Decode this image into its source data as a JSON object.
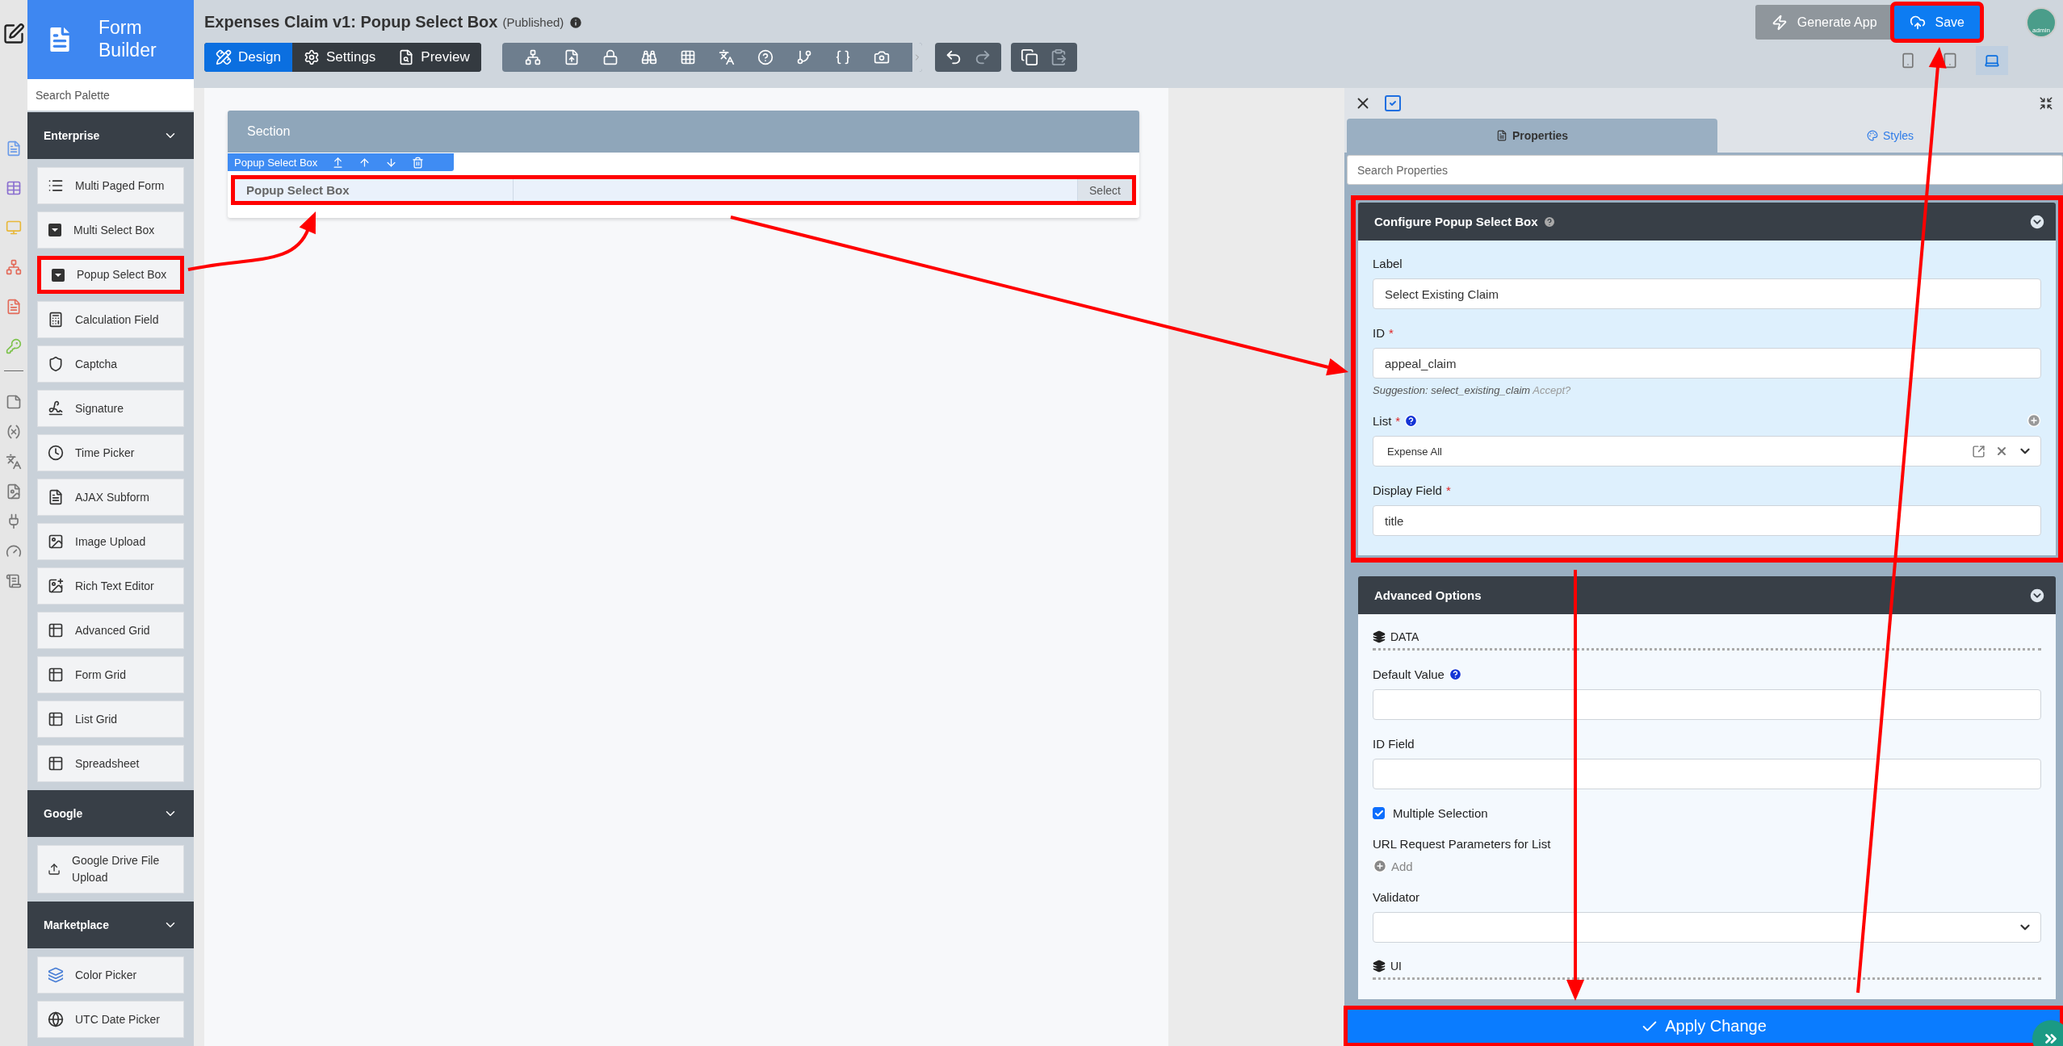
{
  "palette": {
    "title": "Form Builder",
    "search": {
      "placeholder": "Search Palette"
    },
    "groups": [
      {
        "title": "Enterprise",
        "expanded": true,
        "items": [
          {
            "label": "Multi Paged Form",
            "highlighted": false
          },
          {
            "label": "Multi Select Box",
            "highlighted": false
          },
          {
            "label": "Popup Select Box",
            "highlighted": true
          },
          {
            "label": "Calculation Field",
            "highlighted": false
          },
          {
            "label": "Captcha",
            "highlighted": false
          },
          {
            "label": "Signature",
            "highlighted": false
          },
          {
            "label": "Time Picker",
            "highlighted": false
          },
          {
            "label": "AJAX Subform",
            "highlighted": false
          },
          {
            "label": "Image Upload",
            "highlighted": false
          },
          {
            "label": "Rich Text Editor",
            "highlighted": false
          },
          {
            "label": "Advanced Grid",
            "highlighted": false
          },
          {
            "label": "Form Grid",
            "highlighted": false
          },
          {
            "label": "List Grid",
            "highlighted": false
          },
          {
            "label": "Spreadsheet",
            "highlighted": false
          }
        ]
      },
      {
        "title": "Google",
        "expanded": true,
        "items": [
          {
            "label": "Google Drive File Upload",
            "highlighted": false
          }
        ]
      },
      {
        "title": "Marketplace",
        "expanded": true,
        "items": [
          {
            "label": "Color Picker",
            "highlighted": false
          },
          {
            "label": "UTC Date Picker",
            "highlighted": false
          }
        ]
      }
    ]
  },
  "header": {
    "title": "Expenses Claim v1: Popup Select Box",
    "status": "(Published)"
  },
  "mode_tabs": [
    {
      "label": "Design",
      "selected": true
    },
    {
      "label": "Settings",
      "selected": false
    },
    {
      "label": "Preview",
      "selected": false
    }
  ],
  "actions": [
    {
      "label": "Generate App",
      "kind": "secondary",
      "highlighted": false
    },
    {
      "label": "Save",
      "kind": "primary",
      "highlighted": true
    }
  ],
  "avatar": {
    "label": "admin"
  },
  "device_views": [
    {
      "selected": false
    },
    {
      "selected": false
    },
    {
      "selected": true
    }
  ],
  "canvas": {
    "section": {
      "title": "Section"
    },
    "field_toolbar": {
      "label": "Popup Select Box"
    },
    "field": {
      "label": "Popup Select Box",
      "button": "Select",
      "highlighted": true
    }
  },
  "properties": {
    "tabs": [
      {
        "label": "Properties",
        "selected": true
      },
      {
        "label": "Styles",
        "selected": false
      }
    ],
    "search": {
      "placeholder": "Search Properties"
    },
    "sections": [
      {
        "title": "Configure Popup Select Box",
        "help": true,
        "expanded": true,
        "highlighted": true,
        "items": [
          {
            "kind": "text",
            "label": "Label",
            "value": "Select Existing Claim"
          },
          {
            "kind": "text",
            "label": "ID",
            "required_mark": "*",
            "value": "appeal_claim",
            "suggestion": "Suggestion: select_existing_claim",
            "suggestion_action": "Accept?"
          },
          {
            "kind": "list",
            "label": "List",
            "required_mark": "*",
            "help": true,
            "value": "Expense All"
          },
          {
            "kind": "text",
            "label": "Display Field",
            "required_mark": "*",
            "value": "title"
          }
        ]
      },
      {
        "title": "Advanced Options",
        "expanded": true,
        "highlighted": false,
        "items": [
          {
            "kind": "heading",
            "label": "DATA"
          },
          {
            "kind": "text",
            "label": "Default Value",
            "help": true,
            "value": ""
          },
          {
            "kind": "text",
            "label": "ID Field",
            "value": ""
          },
          {
            "kind": "checkbox",
            "label": "Multiple Selection",
            "checked": true
          },
          {
            "kind": "params",
            "label": "URL Request Parameters for List",
            "action": "Add"
          },
          {
            "kind": "select",
            "label": "Validator",
            "value": ""
          },
          {
            "kind": "heading",
            "label": "UI"
          }
        ]
      }
    ]
  },
  "apply": {
    "label": "Apply Change",
    "highlighted": true
  }
}
